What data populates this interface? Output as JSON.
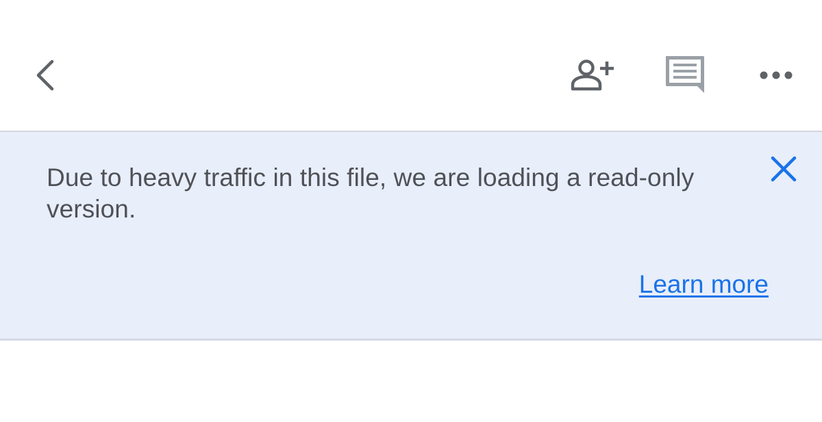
{
  "toolbar": {
    "back_icon": "chevron-left-icon",
    "share_icon": "person-add-icon",
    "comment_icon": "comment-icon",
    "more_icon": "more-horizontal-icon"
  },
  "banner": {
    "message": "Due to heavy traffic in this file, we are loading a read-only version.",
    "close_icon": "close-icon",
    "learn_more_label": "Learn more",
    "background_color": "#e8eefa",
    "link_color": "#1a73e8",
    "text_color": "#4f5157"
  }
}
